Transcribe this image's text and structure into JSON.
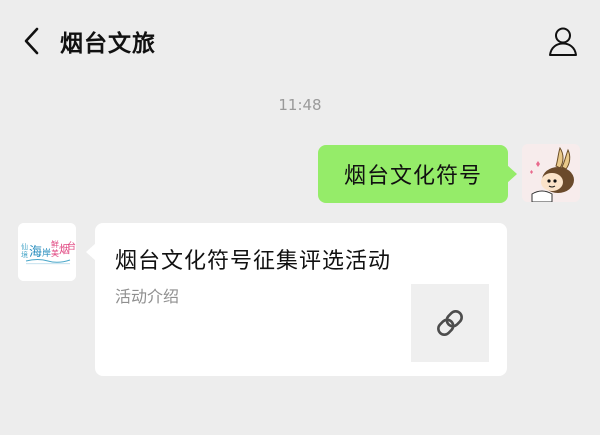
{
  "header": {
    "title": "烟台文旅",
    "back_icon": "chevron-left-icon",
    "profile_icon": "person-icon"
  },
  "chat": {
    "timestamp": "11:48",
    "messages": [
      {
        "sender": "me",
        "text": "烟台文化符号"
      },
      {
        "sender": "account",
        "type": "link-card",
        "title": "烟台文化符号征集评选活动",
        "description": "活动介绍",
        "thumbnail_icon": "link-icon"
      }
    ]
  },
  "account_avatar": {
    "logo_text": [
      "仙",
      "境",
      "海",
      "岸",
      "鲜",
      "美",
      "烟",
      "台"
    ]
  },
  "colors": {
    "background": "#ededed",
    "my_bubble": "#95ec69",
    "card": "#ffffff",
    "muted_text": "#9a9a9a"
  }
}
